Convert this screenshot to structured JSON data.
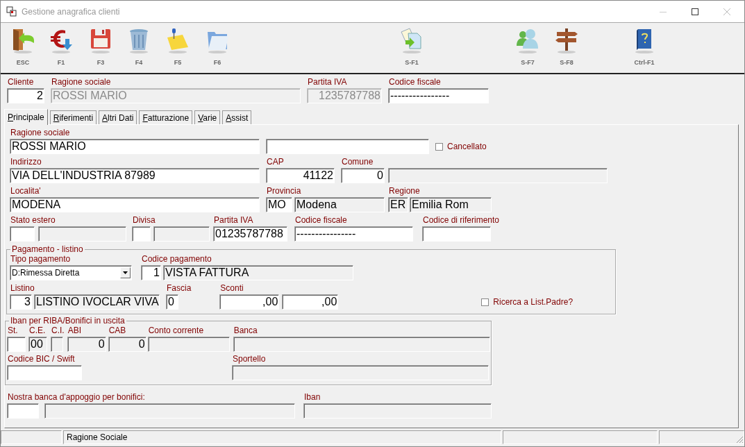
{
  "window": {
    "title": "Gestione anagrafica clienti"
  },
  "toolbar": [
    {
      "key": "ESC",
      "kind": "exit"
    },
    {
      "key": "F1",
      "kind": "euro"
    },
    {
      "key": "F3",
      "kind": "save"
    },
    {
      "key": "F4",
      "kind": "trash"
    },
    {
      "key": "F5",
      "kind": "note"
    },
    {
      "key": "F6",
      "kind": "folder"
    },
    {
      "key": "S-F1",
      "kind": "copy"
    },
    {
      "key": "S-F7",
      "kind": "users"
    },
    {
      "key": "S-F8",
      "kind": "signpost"
    },
    {
      "key": "Ctrl-F1",
      "kind": "help"
    }
  ],
  "header": {
    "rows": [
      {
        "cells": [
          {
            "label": "Cliente",
            "fields": [
              {
                "kind": "number",
                "value": "2",
                "disabled": false,
                "readonly": false
              }
            ]
          },
          {
            "label": "Ragione sociale",
            "fields": [
              {
                "kind": "text",
                "value": "ROSSI MARIO",
                "disabled": true,
                "readonly": true
              }
            ]
          },
          {
            "label": "Partita IVA",
            "fields": [
              {
                "kind": "number",
                "value": "1235787788",
                "disabled": true,
                "readonly": true
              }
            ]
          },
          {
            "label": "Codice fiscale",
            "fields": [
              {
                "kind": "text",
                "value": "----------------",
                "disabled": false,
                "readonly": false
              }
            ]
          }
        ]
      }
    ]
  },
  "tabs": [
    {
      "label": "Principale",
      "selected": true
    },
    {
      "label": "Riferimenti",
      "selected": false
    },
    {
      "label": "Altri Dati",
      "selected": false
    },
    {
      "label": "Fatturazione",
      "selected": false
    },
    {
      "label": "Varie",
      "selected": false
    },
    {
      "label": "Assist",
      "selected": false
    }
  ],
  "principale": {
    "rows": [
      {
        "cells": [
          {
            "label": "Ragione sociale",
            "fields": [
              {
                "kind": "text",
                "value": "ROSSI MARIO",
                "disabled": false,
                "readonly": false
              }
            ]
          },
          {
            "fields": [
              {
                "disabled": false,
                "readonly": false
              }
            ]
          },
          {
            "fields": [
              {
                "kind": "checkbox",
                "label": "Cancellato",
                "checked": false
              }
            ]
          }
        ]
      },
      {
        "cells": [
          {
            "label": "Indirizzo",
            "fields": [
              {
                "kind": "text",
                "value": "VIA DELL'INDUSTRIA 87989",
                "disabled": false,
                "readonly": false
              }
            ]
          },
          {
            "label": "CAP",
            "fields": [
              {
                "kind": "number",
                "value": "41122",
                "disabled": false,
                "readonly": false
              }
            ]
          },
          {
            "label": "Comune",
            "fields": [
              {
                "kind": "number",
                "value": "0",
                "disabled": false,
                "readonly": false
              },
              {
                "disabled": false,
                "readonly": true
              }
            ]
          }
        ]
      },
      {
        "cells": [
          {
            "label": "Localita'",
            "fields": [
              {
                "kind": "text",
                "value": "MODENA",
                "disabled": false,
                "readonly": false
              }
            ]
          },
          {
            "label": "Provincia",
            "fields": [
              {
                "kind": "text",
                "value": "MO",
                "disabled": false,
                "readonly": false
              },
              {
                "kind": "text",
                "value": "Modena",
                "disabled": false,
                "readonly": true
              }
            ]
          },
          {
            "label": "Regione",
            "fields": [
              {
                "kind": "text",
                "value": "ER",
                "disabled": false,
                "readonly": true
              },
              {
                "kind": "text",
                "value": "Emilia Rom",
                "disabled": false,
                "readonly": true
              }
            ]
          }
        ]
      },
      {
        "cells": [
          {
            "label": "Stato estero",
            "fields": [
              {
                "disabled": false,
                "readonly": false
              },
              {
                "disabled": false,
                "readonly": true
              }
            ]
          },
          {
            "label": "Divisa",
            "fields": [
              {
                "disabled": false,
                "readonly": false
              },
              {
                "disabled": false,
                "readonly": true
              }
            ]
          },
          {
            "label": "Partita IVA",
            "fields": [
              {
                "kind": "text",
                "value": "01235787788",
                "disabled": false,
                "readonly": false
              }
            ]
          },
          {
            "label": "Codice fiscale",
            "fields": [
              {
                "kind": "text",
                "value": "----------------",
                "disabled": false,
                "readonly": false
              }
            ]
          },
          {
            "label": "Codice di riferimento",
            "fields": [
              {
                "disabled": false,
                "readonly": false
              }
            ]
          }
        ]
      }
    ]
  },
  "pagamento": {
    "title": "Pagamento - listino",
    "rows": [
      {
        "cells": [
          {
            "label": "Tipo pagamento",
            "fields": [
              {
                "kind": "select",
                "value": "D:Rimessa Diretta",
                "disabled": false,
                "readonly": false
              }
            ]
          },
          {
            "label": "Codice pagamento",
            "fields": [
              {
                "kind": "number",
                "value": "1",
                "disabled": false,
                "readonly": false
              },
              {
                "kind": "text",
                "value": "VISTA FATTURA",
                "disabled": false,
                "readonly": true
              }
            ]
          }
        ]
      },
      {
        "cells": [
          {
            "label": "Listino",
            "fields": [
              {
                "kind": "number",
                "value": "3",
                "disabled": false,
                "readonly": false
              },
              {
                "kind": "text",
                "value": "LISTINO IVOCLAR VIVA",
                "disabled": false,
                "readonly": true
              }
            ]
          },
          {
            "label": "Fascia",
            "fields": [
              {
                "kind": "text",
                "value": "0",
                "disabled": false,
                "readonly": false
              }
            ]
          },
          {
            "label": "Sconti",
            "fields": [
              {
                "kind": "number",
                "value": ",00",
                "disabled": false,
                "readonly": false
              },
              {
                "kind": "number",
                "value": ",00",
                "disabled": false,
                "readonly": false
              }
            ]
          },
          {
            "fields": [
              {
                "kind": "checkbox",
                "label": "Ricerca a List.Padre?",
                "checked": false
              }
            ]
          }
        ]
      }
    ]
  },
  "iban": {
    "title": "Iban per RIBA/Bonifici in uscita",
    "codes": {
      "rows": [
        {
          "cells": [
            {
              "label": "St.",
              "fields": [
                {
                  "disabled": false,
                  "readonly": false
                }
              ]
            },
            {
              "label": "C.E.",
              "fields": [
                {
                  "kind": "text",
                  "value": "00",
                  "disabled": false,
                  "readonly": true
                }
              ]
            },
            {
              "label": "C.I.",
              "fields": [
                {
                  "disabled": false,
                  "readonly": true
                }
              ]
            },
            {
              "label": "ABI",
              "fields": [
                {
                  "kind": "number",
                  "value": "0",
                  "disabled": false,
                  "readonly": true
                }
              ]
            },
            {
              "label": "CAB",
              "fields": [
                {
                  "kind": "number",
                  "value": "0",
                  "disabled": false,
                  "readonly": true
                }
              ]
            },
            {
              "label": "Conto corrente",
              "fields": [
                {
                  "disabled": false,
                  "readonly": true
                }
              ]
            },
            {
              "label": "Banca",
              "fields": [
                {
                  "disabled": false,
                  "readonly": true
                }
              ]
            }
          ]
        }
      ]
    },
    "details": {
      "rows": [
        {
          "cells": [
            {
              "label": "Codice BIC / Swift",
              "fields": [
                {
                  "disabled": false,
                  "readonly": false
                }
              ]
            },
            {
              "label": "Sportello",
              "fields": [
                {
                  "disabled": false,
                  "readonly": true
                }
              ]
            }
          ]
        }
      ]
    }
  },
  "appoggio": {
    "rows": [
      {
        "cells": [
          {
            "label": "Nostra banca d'appoggio per bonifici:",
            "fields": [
              {
                "disabled": false,
                "readonly": false
              },
              {
                "disabled": false,
                "readonly": true
              }
            ]
          },
          {
            "label": "Iban",
            "fields": [
              {
                "disabled": false,
                "readonly": true
              }
            ]
          }
        ]
      }
    ]
  },
  "status_bar": {
    "text": "Ragione Sociale"
  }
}
